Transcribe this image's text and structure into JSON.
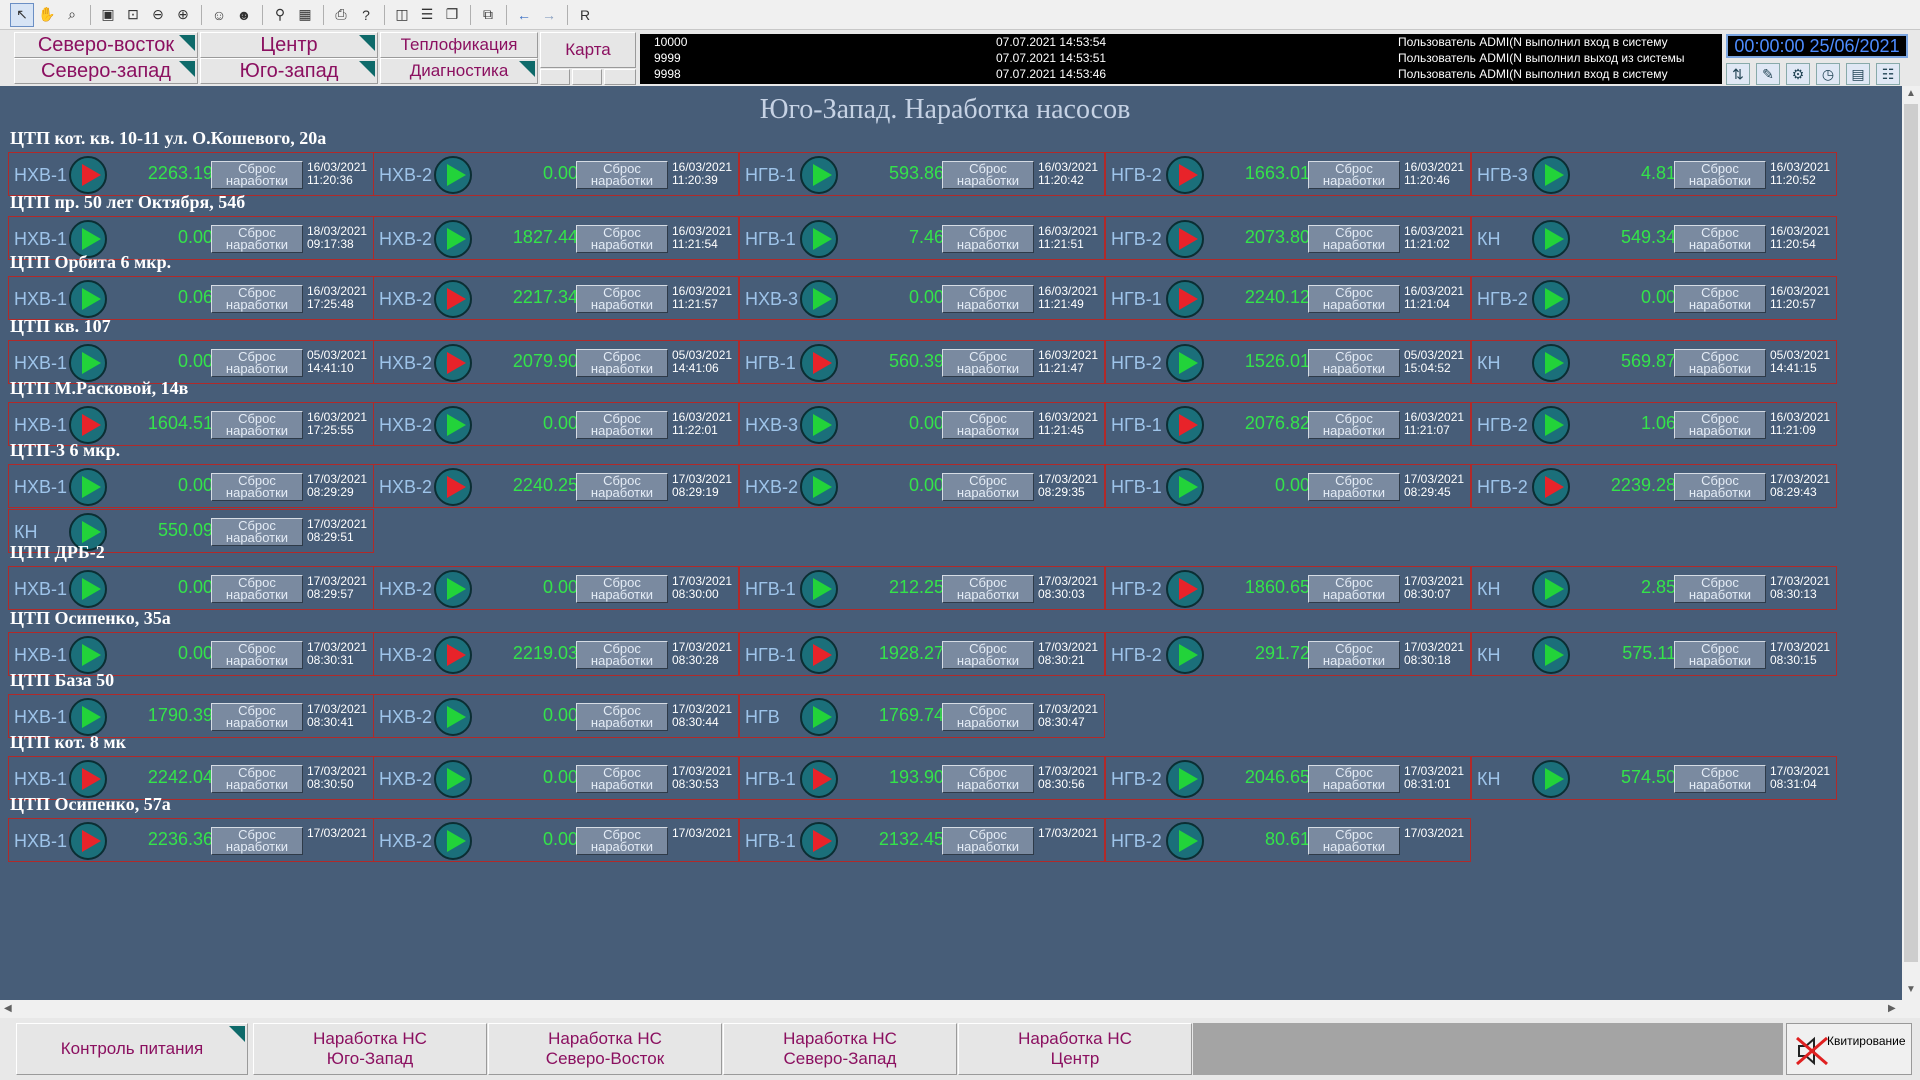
{
  "toolbar": {
    "text_button": "R"
  },
  "nav": {
    "northeast": "Северо-восток",
    "northwest": "Северо-запад",
    "center": "Центр",
    "southwest": "Юго-запад",
    "heating": "Теплофикация",
    "diagnostics": "Диагностика",
    "map": "Карта"
  },
  "log": [
    {
      "id": "10000",
      "time": "07.07.2021 14:53:54",
      "message": "Пользователь ADMI(N выполнил вход в систему"
    },
    {
      "id": "9999",
      "time": "07.07.2021 14:53:51",
      "message": "Пользователь ADMI(N выполнил выход из системы"
    },
    {
      "id": "9998",
      "time": "07.07.2021 14:53:46",
      "message": "Пользователь ADMI(N выполнил вход в систему"
    }
  ],
  "clock": "00:00:00 25/06/2021",
  "page_title": "Юго-Запад. Наработка насосов",
  "reset_label": "Сброс\nнаработки",
  "sections": [
    {
      "title": "ЦТП кот. кв. 10-11 ул. О.Кошевого, 20а",
      "rows": [
        [
          {
            "name": "НХВ-1",
            "state": "off",
            "value": "2263.19",
            "date": "16/03/2021",
            "time": "11:20:36"
          },
          {
            "name": "НХВ-2",
            "state": "on",
            "value": "0.00",
            "date": "16/03/2021",
            "time": "11:20:39"
          },
          {
            "name": "НГВ-1",
            "state": "on",
            "value": "593.86",
            "date": "16/03/2021",
            "time": "11:20:42"
          },
          {
            "name": "НГВ-2",
            "state": "off",
            "value": "1663.01",
            "date": "16/03/2021",
            "time": "11:20:46"
          },
          {
            "name": "НГВ-3",
            "state": "on",
            "value": "4.81",
            "date": "16/03/2021",
            "time": "11:20:52"
          }
        ]
      ]
    },
    {
      "title": "ЦТП пр. 50 лет Октября, 54б",
      "rows": [
        [
          {
            "name": "НХВ-1",
            "state": "on",
            "value": "0.00",
            "date": "18/03/2021",
            "time": "09:17:38"
          },
          {
            "name": "НХВ-2",
            "state": "on",
            "value": "1827.44",
            "date": "16/03/2021",
            "time": "11:21:54"
          },
          {
            "name": "НГВ-1",
            "state": "on",
            "value": "7.46",
            "date": "16/03/2021",
            "time": "11:21:51"
          },
          {
            "name": "НГВ-2",
            "state": "off",
            "value": "2073.80",
            "date": "16/03/2021",
            "time": "11:21:02"
          },
          {
            "name": "КН",
            "state": "on",
            "value": "549.34",
            "date": "16/03/2021",
            "time": "11:20:54"
          }
        ]
      ]
    },
    {
      "title": "ЦТП Орбита 6 мкр.",
      "rows": [
        [
          {
            "name": "НХВ-1",
            "state": "on",
            "value": "0.06",
            "date": "16/03/2021",
            "time": "17:25:48"
          },
          {
            "name": "НХВ-2",
            "state": "off",
            "value": "2217.34",
            "date": "16/03/2021",
            "time": "11:21:57"
          },
          {
            "name": "НХВ-3",
            "state": "on",
            "value": "0.00",
            "date": "16/03/2021",
            "time": "11:21:49"
          },
          {
            "name": "НГВ-1",
            "state": "off",
            "value": "2240.12",
            "date": "16/03/2021",
            "time": "11:21:04"
          },
          {
            "name": "НГВ-2",
            "state": "on",
            "value": "0.00",
            "date": "16/03/2021",
            "time": "11:20:57"
          }
        ]
      ]
    },
    {
      "title": "ЦТП кв. 107",
      "rows": [
        [
          {
            "name": "НХВ-1",
            "state": "on",
            "value": "0.00",
            "date": "05/03/2021",
            "time": "14:41:10"
          },
          {
            "name": "НХВ-2",
            "state": "off",
            "value": "2079.90",
            "date": "05/03/2021",
            "time": "14:41:06"
          },
          {
            "name": "НГВ-1",
            "state": "off",
            "value": "560.39",
            "date": "16/03/2021",
            "time": "11:21:47"
          },
          {
            "name": "НГВ-2",
            "state": "on",
            "value": "1526.01",
            "date": "05/03/2021",
            "time": "15:04:52"
          },
          {
            "name": "КН",
            "state": "on",
            "value": "569.87",
            "date": "05/03/2021",
            "time": "14:41:15"
          }
        ]
      ]
    },
    {
      "title": "ЦТП М.Расковой, 14в",
      "rows": [
        [
          {
            "name": "НХВ-1",
            "state": "off",
            "value": "1604.51",
            "date": "16/03/2021",
            "time": "17:25:55"
          },
          {
            "name": "НХВ-2",
            "state": "on",
            "value": "0.00",
            "date": "16/03/2021",
            "time": "11:22:01"
          },
          {
            "name": "НХВ-3",
            "state": "on",
            "value": "0.00",
            "date": "16/03/2021",
            "time": "11:21:45"
          },
          {
            "name": "НГВ-1",
            "state": "off",
            "value": "2076.82",
            "date": "16/03/2021",
            "time": "11:21:07"
          },
          {
            "name": "НГВ-2",
            "state": "on",
            "value": "1.06",
            "date": "16/03/2021",
            "time": "11:21:09"
          }
        ]
      ]
    },
    {
      "title": "ЦТП-3 6 мкр.",
      "rows": [
        [
          {
            "name": "НХВ-1",
            "state": "on",
            "value": "0.00",
            "date": "17/03/2021",
            "time": "08:29:29"
          },
          {
            "name": "НХВ-2",
            "state": "off",
            "value": "2240.25",
            "date": "17/03/2021",
            "time": "08:29:19"
          },
          {
            "name": "НХВ-2",
            "state": "on",
            "value": "0.00",
            "date": "17/03/2021",
            "time": "08:29:35"
          },
          {
            "name": "НГВ-1",
            "state": "on",
            "value": "0.00",
            "date": "17/03/2021",
            "time": "08:29:45"
          },
          {
            "name": "НГВ-2",
            "state": "off",
            "value": "2239.28",
            "date": "17/03/2021",
            "time": "08:29:43"
          }
        ],
        [
          {
            "name": "КН",
            "state": "on",
            "value": "550.09",
            "date": "17/03/2021",
            "time": "08:29:51"
          }
        ]
      ]
    },
    {
      "title": "ЦТП ДРБ-2",
      "rows": [
        [
          {
            "name": "НХВ-1",
            "state": "on",
            "value": "0.00",
            "date": "17/03/2021",
            "time": "08:29:57"
          },
          {
            "name": "НХВ-2",
            "state": "on",
            "value": "0.00",
            "date": "17/03/2021",
            "time": "08:30:00"
          },
          {
            "name": "НГВ-1",
            "state": "on",
            "value": "212.25",
            "date": "17/03/2021",
            "time": "08:30:03"
          },
          {
            "name": "НГВ-2",
            "state": "off",
            "value": "1860.65",
            "date": "17/03/2021",
            "time": "08:30:07"
          },
          {
            "name": "КН",
            "state": "on",
            "value": "2.85",
            "date": "17/03/2021",
            "time": "08:30:13"
          }
        ]
      ]
    },
    {
      "title": "ЦТП Осипенко, 35а",
      "rows": [
        [
          {
            "name": "НХВ-1",
            "state": "on",
            "value": "0.00",
            "date": "17/03/2021",
            "time": "08:30:31"
          },
          {
            "name": "НХВ-2",
            "state": "off",
            "value": "2219.03",
            "date": "17/03/2021",
            "time": "08:30:28"
          },
          {
            "name": "НГВ-1",
            "state": "off",
            "value": "1928.27",
            "date": "17/03/2021",
            "time": "08:30:21"
          },
          {
            "name": "НГВ-2",
            "state": "on",
            "value": "291.72",
            "date": "17/03/2021",
            "time": "08:30:18"
          },
          {
            "name": "КН",
            "state": "on",
            "value": "575.11",
            "date": "17/03/2021",
            "time": "08:30:15"
          }
        ]
      ]
    },
    {
      "title": "ЦТП База 50",
      "rows": [
        [
          {
            "name": "НХВ-1",
            "state": "on",
            "value": "1790.39",
            "date": "17/03/2021",
            "time": "08:30:41"
          },
          {
            "name": "НХВ-2",
            "state": "on",
            "value": "0.00",
            "date": "17/03/2021",
            "time": "08:30:44"
          },
          {
            "name": "НГВ",
            "state": "on",
            "value": "1769.74",
            "date": "17/03/2021",
            "time": "08:30:47"
          }
        ]
      ]
    },
    {
      "title": "ЦТП кот. 8 мк",
      "rows": [
        [
          {
            "name": "НХВ-1",
            "state": "off",
            "value": "2242.04",
            "date": "17/03/2021",
            "time": "08:30:50"
          },
          {
            "name": "НХВ-2",
            "state": "on",
            "value": "0.00",
            "date": "17/03/2021",
            "time": "08:30:53"
          },
          {
            "name": "НГВ-1",
            "state": "off",
            "value": "193.90",
            "date": "17/03/2021",
            "time": "08:30:56"
          },
          {
            "name": "НГВ-2",
            "state": "on",
            "value": "2046.65",
            "date": "17/03/2021",
            "time": "08:31:01"
          },
          {
            "name": "КН",
            "state": "on",
            "value": "574.50",
            "date": "17/03/2021",
            "time": "08:31:04"
          }
        ]
      ]
    },
    {
      "title": "ЦТП Осипенко, 57а",
      "rows": [
        [
          {
            "name": "НХВ-1",
            "state": "off",
            "value": "2236.36",
            "date": "17/03/2021",
            "time": ""
          },
          {
            "name": "НХВ-2",
            "state": "on",
            "value": "0.00",
            "date": "17/03/2021",
            "time": ""
          },
          {
            "name": "НГВ-1",
            "state": "off",
            "value": "2132.45",
            "date": "17/03/2021",
            "time": ""
          },
          {
            "name": "НГВ-2",
            "state": "on",
            "value": "80.61",
            "date": "17/03/2021",
            "time": ""
          }
        ]
      ]
    }
  ],
  "footer": {
    "power_control": "Контроль питания",
    "tabs": [
      {
        "line1": "Наработка НС",
        "line2": "Юго-Запад"
      },
      {
        "line1": "Наработка НС",
        "line2": "Северо-Восток"
      },
      {
        "line1": "Наработка НС",
        "line2": "Северо-Запад"
      },
      {
        "line1": "Наработка НС",
        "line2": "Центр"
      }
    ],
    "acknowledge": "Квитирование"
  },
  "colors": {
    "background": "#475d78",
    "value_green": "#34e34a",
    "pump_on": "#22d33a",
    "pump_off": "#e8232a",
    "nav_text": "#8b1060"
  }
}
